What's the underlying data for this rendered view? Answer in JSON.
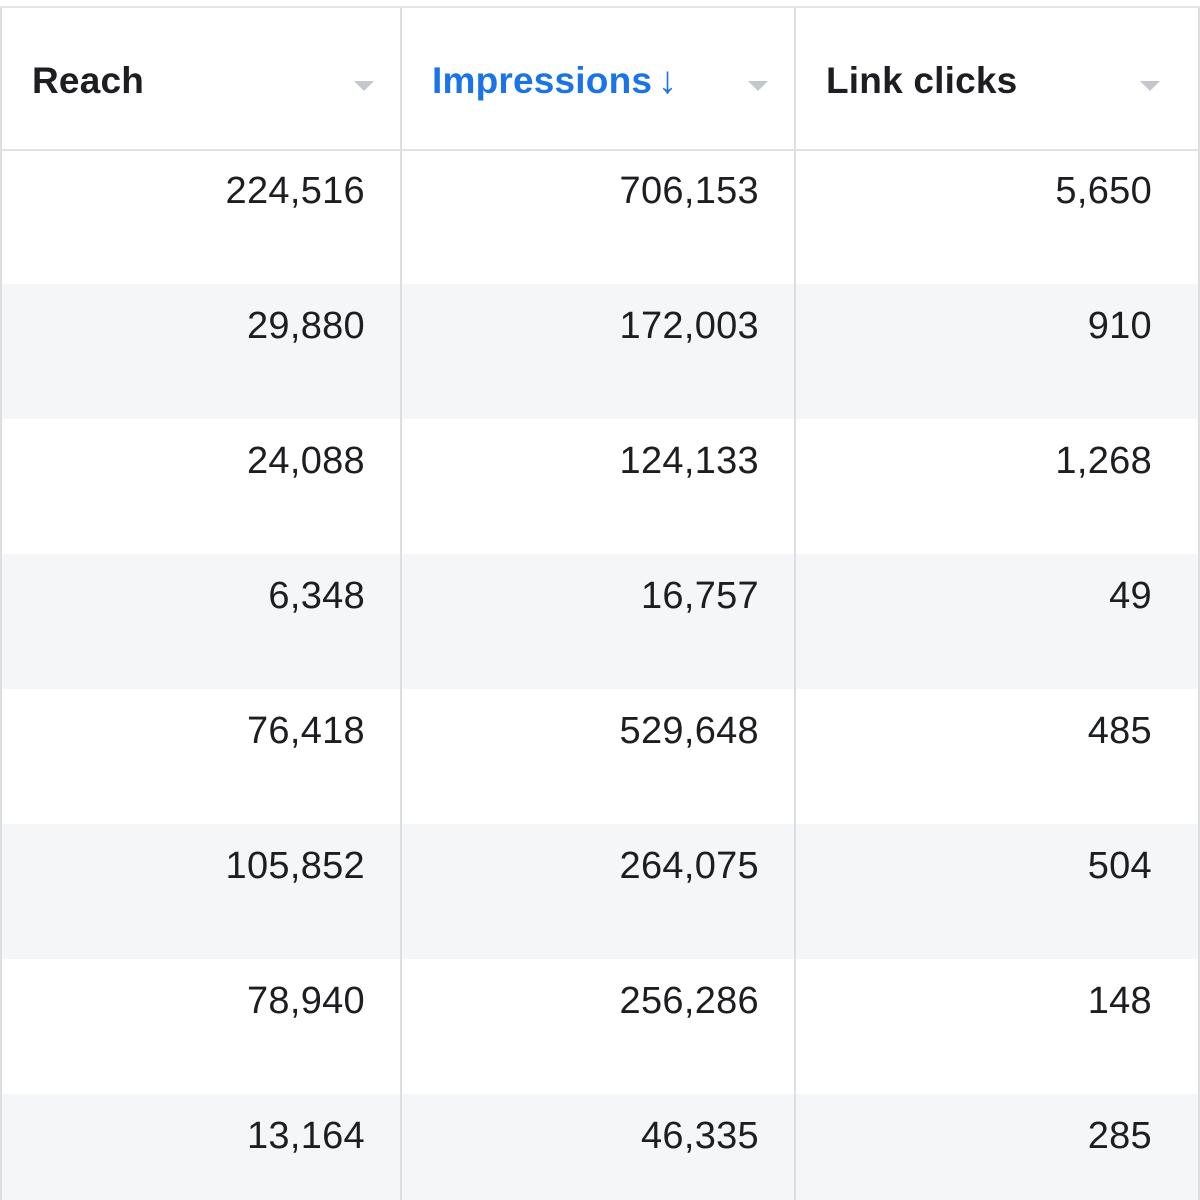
{
  "columns": [
    {
      "label": "Reach",
      "sorted": false
    },
    {
      "label": "Impressions",
      "sorted": true,
      "sort_icon": "arrow-down-icon",
      "sort_glyph": "↓"
    },
    {
      "label": "Link clicks",
      "sorted": false
    }
  ],
  "rows": [
    [
      "224,516",
      "706,153",
      "5,650"
    ],
    [
      "29,880",
      "172,003",
      "910"
    ],
    [
      "24,088",
      "124,133",
      "1,268"
    ],
    [
      "6,348",
      "16,757",
      "49"
    ],
    [
      "76,418",
      "529,648",
      "485"
    ],
    [
      "105,852",
      "264,075",
      "504"
    ],
    [
      "78,940",
      "256,286",
      "148"
    ],
    [
      "13,164",
      "46,335",
      "285"
    ]
  ],
  "colors": {
    "sorted_header": "#1a73e8",
    "text": "#1c1e21",
    "alt_row": "#f5f6f7",
    "grid": "#dcdee1"
  }
}
